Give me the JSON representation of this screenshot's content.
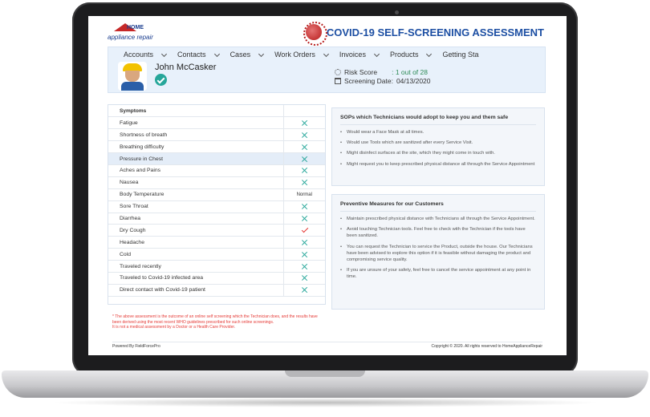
{
  "app": {
    "title": "COVID-19 SELF-SCREENING ASSESSMENT",
    "logo_top": "HOME",
    "logo_bottom": "appliance repair"
  },
  "nav": {
    "items": [
      "Accounts",
      "Contacts",
      "Cases",
      "Work Orders",
      "Invoices",
      "Products",
      "Getting Sta"
    ]
  },
  "technician": {
    "name": "John McCasker",
    "risk_label": "Risk Score",
    "risk_value": ": 1 out of 28",
    "screening_label": "Screening Date:",
    "screening_date": "04/13/2020"
  },
  "symptoms": {
    "header": "Symptoms",
    "rows": [
      {
        "label": "Fatigue",
        "result": "no"
      },
      {
        "label": "Shortness of breath",
        "result": "no"
      },
      {
        "label": "Breathing difficulty",
        "result": "no"
      },
      {
        "label": "Pressure in Chest",
        "result": "no"
      },
      {
        "label": "Aches and Pains",
        "result": "no"
      },
      {
        "label": "Nausea",
        "result": "no"
      },
      {
        "label": "Body Temperature",
        "result": "text",
        "text": "Normal"
      },
      {
        "label": "Sore Throat",
        "result": "no"
      },
      {
        "label": "Diarrhea",
        "result": "no"
      },
      {
        "label": "Dry Cough",
        "result": "yes"
      },
      {
        "label": "Headache",
        "result": "no"
      },
      {
        "label": "Cold",
        "result": "no"
      },
      {
        "label": "Traveled recently",
        "result": "no"
      },
      {
        "label": "Traveled to Covid-19 infected area",
        "result": "no"
      },
      {
        "label": "Direct contact with Covid-19 patient",
        "result": "no"
      }
    ]
  },
  "sop": {
    "title": "SOPs which Technicians would adopt to keep you and them safe",
    "items": [
      "Would wear a Face Mask at all times.",
      "Would use Tools which are sanitized after every Service Visit.",
      "Might disinfect surfaces at the site, which they might come in touch with.",
      "Might request you to keep prescribed physical distance all through the Service Appointment"
    ]
  },
  "preventive": {
    "title": "Preventive Measures for our Customers",
    "items": [
      "Maintain prescribed physical distance with Technicians all through the Service Appointment.",
      "Avoid touching Technician tools. Feel free to check with the Technician if the tools have been sanitized.",
      "You can request the Technician to service the Product, outside the house. Our Technicians have been advised to explore this option if it is feasible without damaging the product and compromising service quality.",
      "If you are unsure of your safety, feel free to cancel the service appointment at any point in time."
    ]
  },
  "disclaimer": {
    "line1": "* The above assessment is the outcome of an online self screening which the Technician does, and the results have been derived using the most recent WHO guidelines prescribed for such online screenings.",
    "line2": "It is not a medical assessment by a Doctor or a Health Care Provider."
  },
  "footer": {
    "powered": "Powered By FieldForcePro",
    "copyright": "Copyright © 2020. All rights reserved to HomeApplianceRepair"
  }
}
